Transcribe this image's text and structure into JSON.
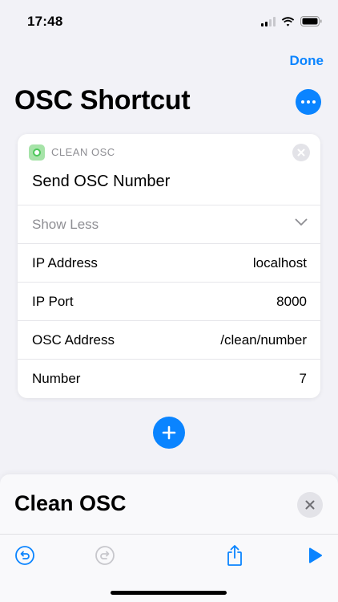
{
  "status_bar": {
    "time": "17:48"
  },
  "header": {
    "done_label": "Done",
    "title": "OSC Shortcut"
  },
  "action_card": {
    "app_name": "CLEAN OSC",
    "action_title": "Send OSC Number",
    "show_less_label": "Show Less",
    "params": [
      {
        "label": "IP Address",
        "value": "localhost"
      },
      {
        "label": "IP Port",
        "value": "8000"
      },
      {
        "label": "OSC Address",
        "value": "/clean/number"
      },
      {
        "label": "Number",
        "value": "7"
      }
    ]
  },
  "sheet": {
    "title": "Clean OSC"
  },
  "colors": {
    "accent": "#0a84ff",
    "background": "#f2f2f7",
    "app_icon": "#4cc75a"
  },
  "icons": {
    "more": "ellipsis-icon",
    "remove": "close-icon",
    "chevron": "chevron-down-icon",
    "add": "plus-icon",
    "undo": "undo-icon",
    "redo": "redo-icon",
    "share": "share-icon",
    "run": "play-icon"
  }
}
